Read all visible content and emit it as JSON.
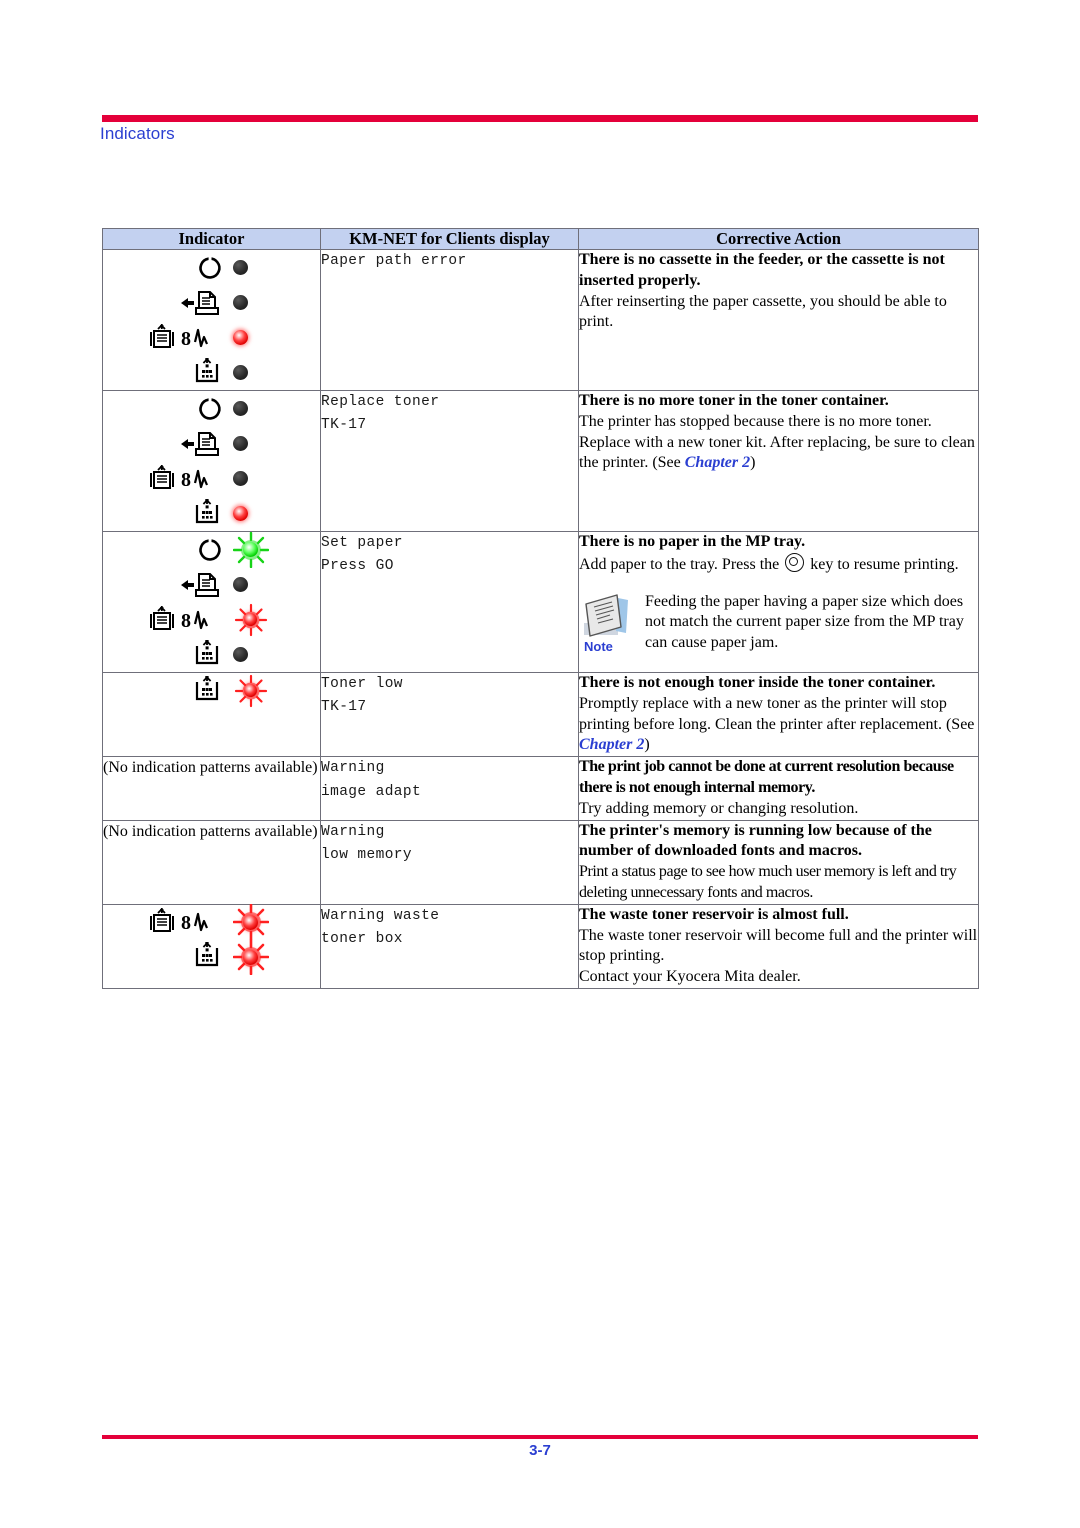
{
  "page": {
    "running_head": "Indicators",
    "page_number": "3-7",
    "rule_color": "#e4003a",
    "heading_color": "#2b3fd1"
  },
  "table": {
    "headers": [
      "Indicator",
      "KM-NET for Clients display",
      "Corrective Action"
    ],
    "header_bg": "#c3d1f0",
    "rows": [
      {
        "id": "paper-path-error",
        "indicator_type": "lamps",
        "lamps": [
          {
            "icon": "ready-icon",
            "state": "off"
          },
          {
            "icon": "data-paper-icon",
            "state": "off"
          },
          {
            "icon": "attention-jam-icon",
            "state": "on-red"
          },
          {
            "icon": "toner-icon",
            "state": "off"
          }
        ],
        "display": [
          "Paper path error"
        ],
        "action_head": "There is no cassette in the feeder, or the cassette is not inserted properly.",
        "action_body": "After reinserting the paper cassette, you should be able to print.",
        "chapter_ref": null,
        "note": null
      },
      {
        "id": "replace-toner",
        "indicator_type": "lamps",
        "lamps": [
          {
            "icon": "ready-icon",
            "state": "off"
          },
          {
            "icon": "data-paper-icon",
            "state": "off"
          },
          {
            "icon": "attention-jam-icon",
            "state": "off"
          },
          {
            "icon": "toner-icon",
            "state": "on-red"
          }
        ],
        "display": [
          "Replace toner",
          "TK-17"
        ],
        "action_head": "There is no more toner in the toner container.",
        "action_body_pre": "The printer has stopped because there is no more toner. Replace with a new toner kit. After replacing, be sure to clean the printer. (See ",
        "chapter_ref": "Chapter 2",
        "action_body_post": ")",
        "note": null
      },
      {
        "id": "set-paper",
        "indicator_type": "lamps",
        "lamps": [
          {
            "icon": "ready-icon",
            "state": "blink-green"
          },
          {
            "icon": "data-paper-icon",
            "state": "off"
          },
          {
            "icon": "attention-jam-icon",
            "state": "blink-red"
          },
          {
            "icon": "toner-icon",
            "state": "off"
          }
        ],
        "display": [
          "Set paper",
          "Press GO"
        ],
        "action_head": "There is no paper in the MP tray.",
        "action_body_pre": "Add paper to the tray. Press the ",
        "action_key_icon": "go-key-icon",
        "action_body_post": " key to resume printing.",
        "note": {
          "label": "Note",
          "icon": "note-document-icon",
          "text": "Feeding the paper having a paper size which does not match the current paper size from the MP tray can cause paper jam."
        }
      },
      {
        "id": "toner-low",
        "indicator_type": "lamps",
        "lamps": [
          {
            "icon": "toner-icon",
            "state": "blink-red"
          }
        ],
        "display": [
          "Toner low",
          "TK-17"
        ],
        "action_head": "There is not enough toner inside the toner container.",
        "action_body_pre": "Promptly replace with a new toner as the printer will stop printing before long. Clean the printer after replacement. (See ",
        "chapter_ref": "Chapter 2",
        "action_body_post": ")",
        "note": null
      },
      {
        "id": "warning-image-adapt",
        "indicator_type": "text",
        "indicator_text": "(No indication patterns available)",
        "display": [
          "Warning",
          "image adapt"
        ],
        "action_head": "The print job cannot be done at current resolution because there is not enough internal memory.",
        "action_body": "Try adding memory or changing resolution.",
        "chapter_ref": null,
        "note": null
      },
      {
        "id": "warning-low-memory",
        "indicator_type": "text",
        "indicator_text": "(No indication patterns available)",
        "display": [
          "Warning",
          "low memory"
        ],
        "action_head": "The printer's memory is running low because of the number of downloaded fonts and macros.",
        "action_body": "Print a status page to see how much user memory is left and try deleting unnecessary fonts and macros.",
        "chapter_ref": null,
        "note": null
      },
      {
        "id": "warning-waste-toner-box",
        "indicator_type": "lamps",
        "lamps": [
          {
            "icon": "attention-jam-icon",
            "state": "blink-red"
          },
          {
            "icon": "toner-icon",
            "state": "blink-red"
          }
        ],
        "display": [
          "Warning waste",
          "toner box"
        ],
        "action_head": "The waste toner reservoir is almost full.",
        "action_body": "The waste toner reservoir will become full and the printer will stop printing.\nContact your Kyocera Mita dealer.",
        "chapter_ref": null,
        "note": null
      }
    ]
  }
}
